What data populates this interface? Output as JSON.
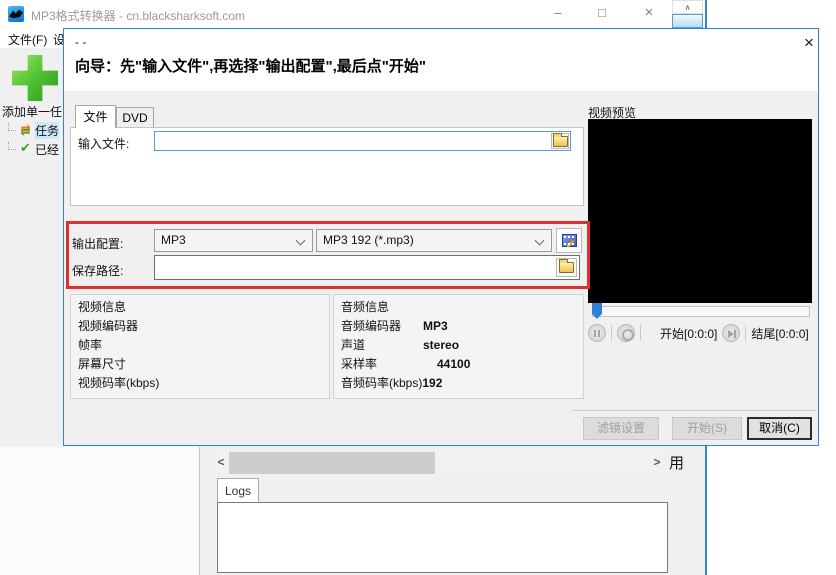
{
  "colors": {
    "dialog_border_blue": "#2e84d8",
    "highlight_red": "#e03131",
    "tree_selection_blue": "#cbe8fa",
    "preview_black": "#000000"
  },
  "main_window": {
    "title": "MP3格式转换器 - cn.blacksharksoft.com",
    "controls": {
      "minimize": "–",
      "maximize": "□",
      "close": "×"
    },
    "menu": {
      "file": "文件(F)",
      "second_partial": "设"
    },
    "left_panel": {
      "add_task_label": "添加单一任",
      "tree_items": [
        {
          "label": "任务"
        },
        {
          "label": "已经"
        }
      ]
    },
    "scroll_glyphs": {
      "up": "∧",
      "left": "<",
      "right": ">"
    },
    "apply_partial": "用",
    "logs_tab_label": "Logs"
  },
  "dialog": {
    "title": "- -",
    "close": "×",
    "wizard_text": "向导：先\"输入文件\",再选择\"输出配置\",最后点\"开始\"",
    "tabs": [
      {
        "label": "文件"
      },
      {
        "label": "DVD"
      }
    ],
    "input_file": {
      "label": "输入文件:",
      "value": ""
    },
    "output_config": {
      "label": "输出配置:",
      "format_value": "MP3",
      "profile_value": "MP3 192 (*.mp3)"
    },
    "save_path": {
      "label": "保存路径:",
      "value": ""
    },
    "video_info": {
      "title": "视频信息",
      "rows": [
        {
          "label": "视频编码器",
          "value": ""
        },
        {
          "label": "帧率",
          "value": ""
        },
        {
          "label": "屏幕尺寸",
          "value": ""
        },
        {
          "label": "视频码率(kbps)",
          "value": ""
        }
      ]
    },
    "audio_info": {
      "title": "音频信息",
      "rows": [
        {
          "label": "音频编码器",
          "value": "MP3"
        },
        {
          "label": "声道",
          "value": "stereo"
        },
        {
          "label": "采样率",
          "value": "44100"
        },
        {
          "label": "音频码率(kbps)",
          "value": "192"
        }
      ]
    },
    "preview": {
      "title": "视频预览",
      "start_label": "开始[0:0:0]",
      "end_label": "结尾[0:0:0]"
    },
    "footer_buttons": {
      "filter": "滤镜设置",
      "start": "开始(S)",
      "cancel": "取消(C)"
    }
  }
}
